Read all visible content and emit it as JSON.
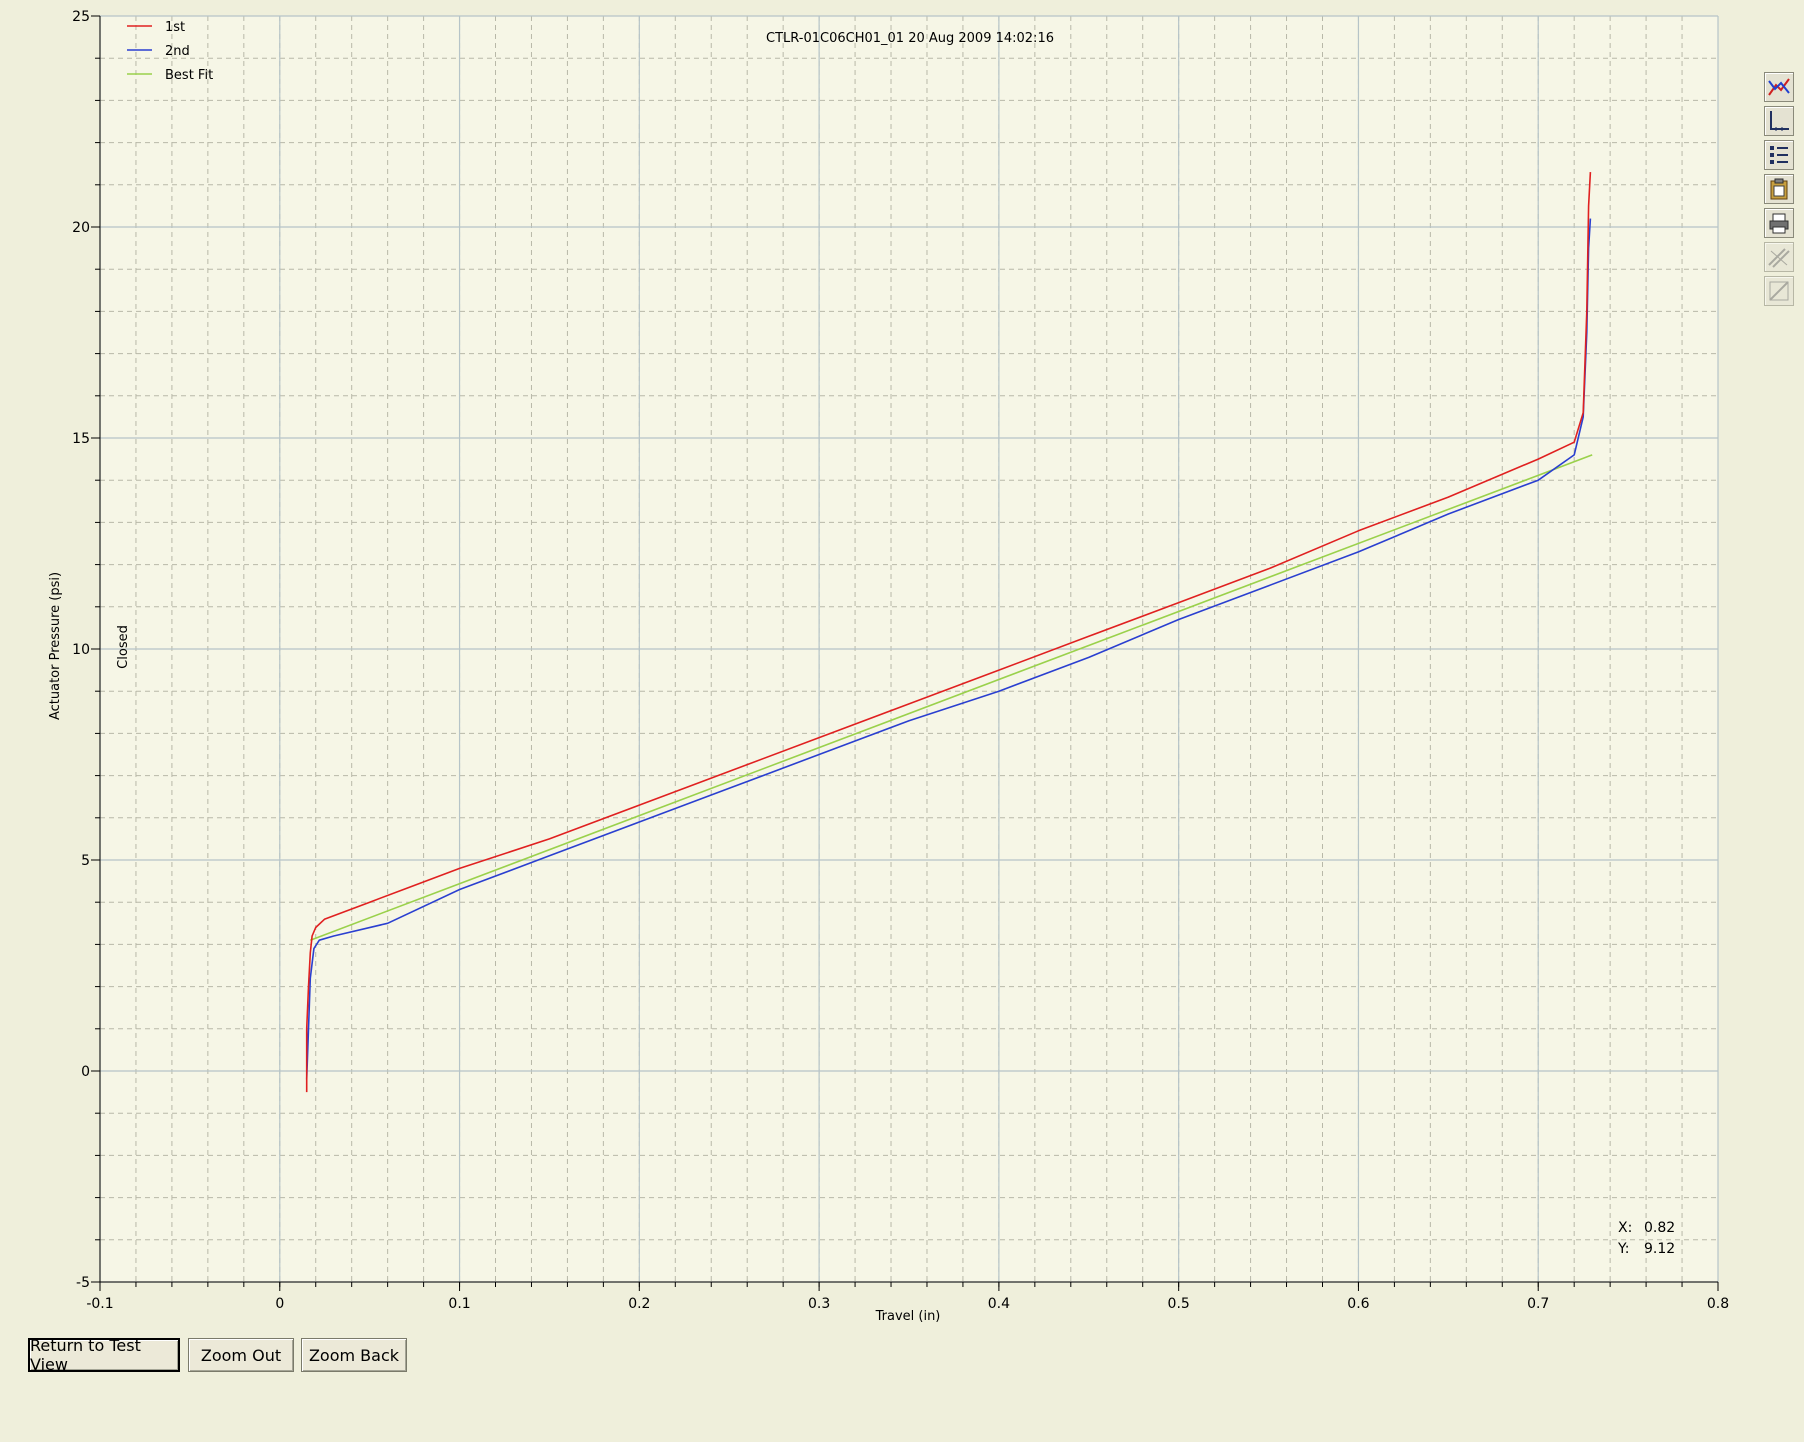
{
  "chart_data": {
    "type": "line",
    "title": "CTLR-01C06CH01_01 20 Aug 2009 14:02:16",
    "xlabel": "Travel (in)",
    "ylabel": "Actuator Pressure (psi)",
    "xlim": [
      -0.1,
      0.8
    ],
    "ylim": [
      -5,
      25
    ],
    "x_ticks": [
      "-0.1",
      "0",
      "0.1",
      "0.2",
      "0.3",
      "0.4",
      "0.5",
      "0.6",
      "0.7",
      "0.8"
    ],
    "y_ticks": [
      "-5",
      "0",
      "5",
      "10",
      "15",
      "20",
      "25"
    ],
    "grid": true,
    "legend_position": "top-left",
    "annotation": "Closed",
    "series": [
      {
        "name": "1st",
        "color": "#e02020",
        "x": [
          0.015,
          0.015,
          0.016,
          0.017,
          0.018,
          0.02,
          0.025,
          0.05,
          0.1,
          0.15,
          0.2,
          0.25,
          0.3,
          0.35,
          0.4,
          0.45,
          0.5,
          0.55,
          0.6,
          0.65,
          0.7,
          0.72,
          0.725,
          0.727,
          0.728,
          0.729
        ],
        "y": [
          -0.5,
          1.0,
          2.0,
          2.8,
          3.2,
          3.4,
          3.6,
          4.0,
          4.8,
          5.5,
          6.3,
          7.1,
          7.9,
          8.7,
          9.5,
          10.3,
          11.1,
          11.9,
          12.8,
          13.6,
          14.5,
          14.9,
          15.6,
          18.0,
          20.5,
          21.3
        ]
      },
      {
        "name": "2nd",
        "color": "#2a3fd0",
        "x": [
          0.015,
          0.016,
          0.017,
          0.019,
          0.022,
          0.03,
          0.06,
          0.1,
          0.15,
          0.2,
          0.25,
          0.3,
          0.35,
          0.4,
          0.45,
          0.5,
          0.55,
          0.6,
          0.65,
          0.7,
          0.72,
          0.725,
          0.727,
          0.728,
          0.729
        ],
        "y": [
          -0.2,
          1.0,
          2.2,
          2.9,
          3.1,
          3.2,
          3.5,
          4.3,
          5.1,
          5.9,
          6.7,
          7.5,
          8.3,
          9.0,
          9.8,
          10.7,
          11.5,
          12.3,
          13.2,
          14.0,
          14.6,
          15.5,
          17.5,
          19.5,
          20.2
        ]
      },
      {
        "name": "Best Fit",
        "color": "#9ad14b",
        "x": [
          0.017,
          0.73
        ],
        "y": [
          3.1,
          14.6
        ]
      }
    ]
  },
  "readout": {
    "x_label": "X:",
    "x_value": "0.82",
    "y_label": "Y:",
    "y_value": "9.12"
  },
  "buttons": {
    "return_label": "Return to Test View",
    "zoom_out_label": "Zoom Out",
    "zoom_back_label": "Zoom Back"
  },
  "toolbar": {
    "icons": [
      "chart-line-icon",
      "axis-icon",
      "legend-icon",
      "clipboard-icon",
      "print-icon",
      "hatch-icon",
      "sample-icon"
    ]
  }
}
